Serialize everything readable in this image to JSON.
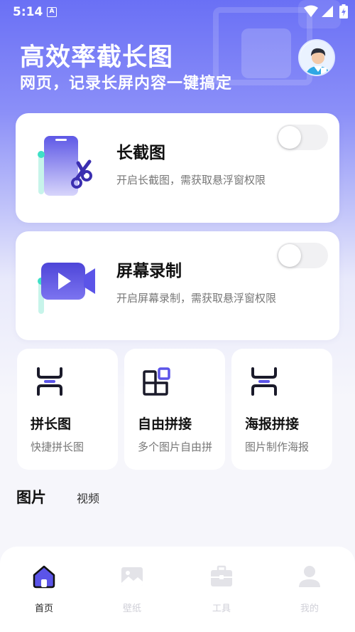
{
  "status_bar": {
    "time": "5:14",
    "a_icon": "A"
  },
  "header": {
    "title": "高效率截长图",
    "subtitle": "网页，记录长屏内容一键搞定"
  },
  "cards": [
    {
      "title": "长截图",
      "desc": "开启长截图，需获取悬浮窗权限",
      "icon": "phone-scissors-icon",
      "toggle_on": false
    },
    {
      "title": "屏幕录制",
      "desc": "开启屏幕录制，需获取悬浮窗权限",
      "icon": "video-camera-icon",
      "toggle_on": false
    }
  ],
  "tools": [
    {
      "title": "拼长图",
      "desc": "快捷拼长图",
      "icon": "stitch-long-icon"
    },
    {
      "title": "自由拼接",
      "desc": "多个图片自由拼",
      "icon": "grid-icon"
    },
    {
      "title": "海报拼接",
      "desc": "图片制作海报",
      "icon": "stitch-poster-icon"
    }
  ],
  "tabs": {
    "pictures": "图片",
    "videos": "视频"
  },
  "nav": [
    {
      "label": "首页",
      "icon": "home-icon",
      "active": true
    },
    {
      "label": "壁纸",
      "icon": "image-icon",
      "active": false
    },
    {
      "label": "工具",
      "icon": "toolbox-icon",
      "active": false
    },
    {
      "label": "我的",
      "icon": "user-icon",
      "active": false
    }
  ],
  "colors": {
    "accent": "#5b54e8",
    "hero_top": "#6a70f5",
    "teal": "#3ee0c6"
  }
}
